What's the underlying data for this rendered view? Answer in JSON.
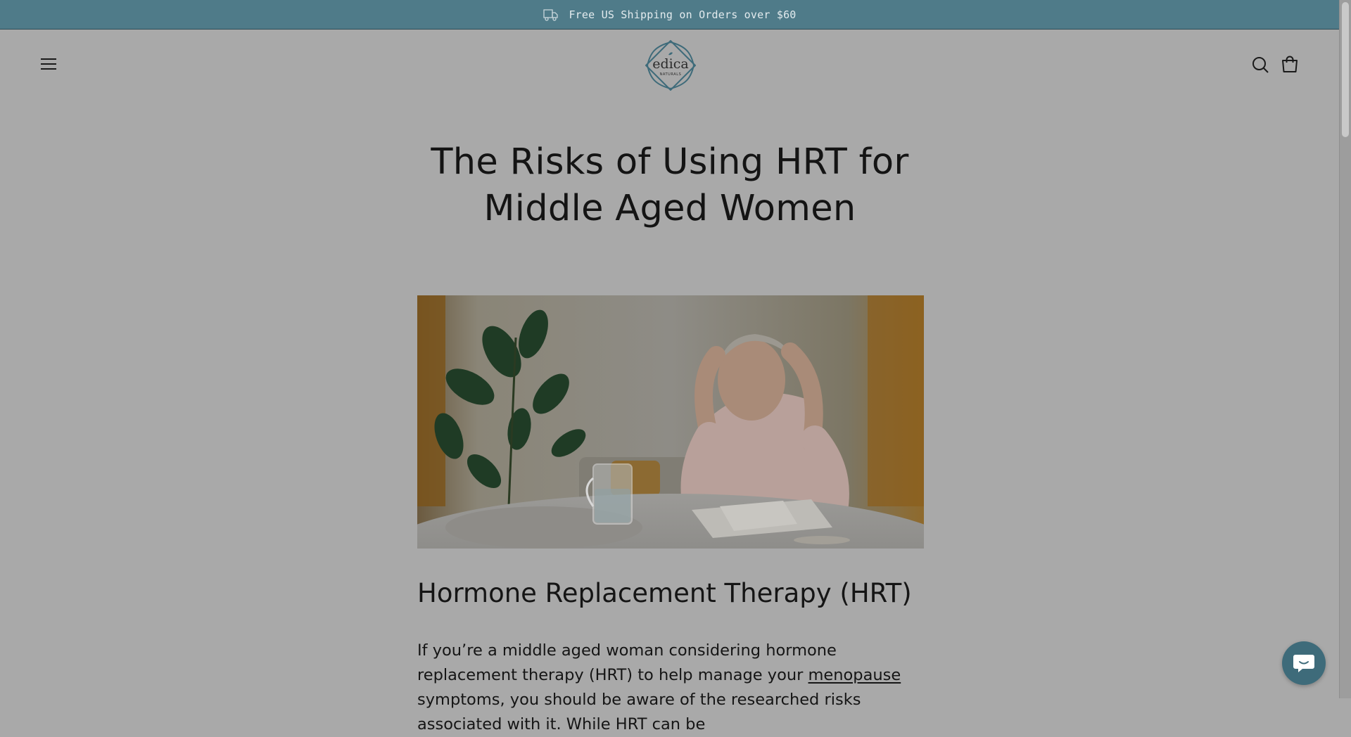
{
  "announcement": {
    "text": "Free US Shipping on Orders over $60",
    "icon": "truck-icon"
  },
  "header": {
    "logo": {
      "brand": "edica",
      "tagline": "NATURALS"
    },
    "icons": [
      "menu-icon",
      "search-icon",
      "cart-icon"
    ]
  },
  "article": {
    "title_line1": "The Risks of Using HRT for",
    "title_line2": "Middle Aged Women",
    "section_heading": "Hormone Replacement Therapy (HRT)",
    "paragraph": {
      "before_link": "If you’re a middle aged woman considering hormone replacement therapy (HRT) to help manage your ",
      "link_text": "menopause",
      "after_link": " symptoms, you should be aware of the researched risks associated with it. While HRT can be"
    }
  },
  "chat": {
    "icon": "chat-bubble-icon"
  },
  "colors": {
    "announcement_bg": "#4f7b89",
    "page_overlay": "#a9a9a9",
    "accent": "#3e6b7a"
  }
}
